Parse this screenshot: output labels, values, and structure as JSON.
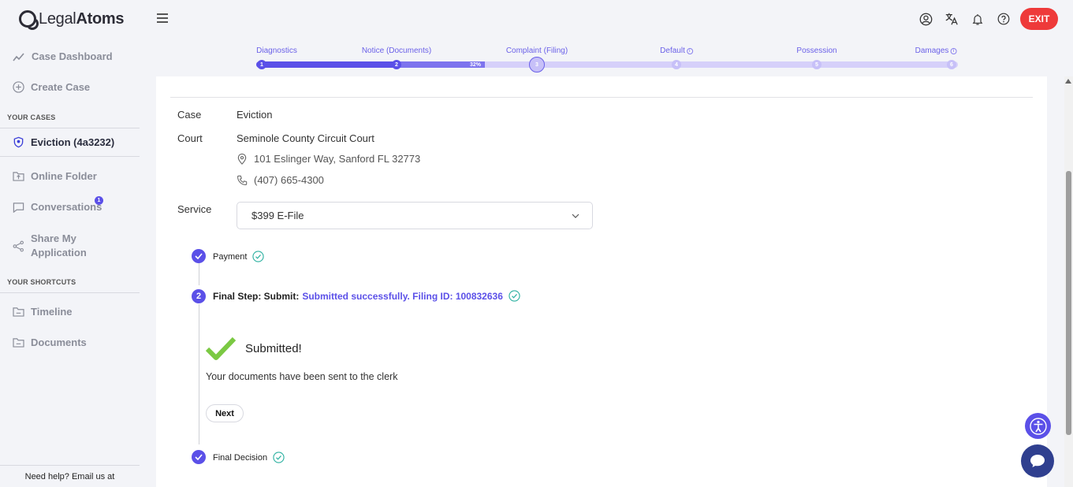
{
  "header": {
    "logo_light": "Legal",
    "logo_bold": "Atoms",
    "exit_label": "EXIT",
    "icons": [
      "user-icon",
      "translate-icon",
      "bell-icon",
      "help-icon"
    ]
  },
  "progress": {
    "steps": [
      {
        "label": "Diagnostics",
        "number": "1",
        "state": "done"
      },
      {
        "label": "Notice (Documents)",
        "number": "2",
        "state": "done"
      },
      {
        "label": "Complaint (Filing)",
        "number": "3",
        "state": "current"
      },
      {
        "label": "Default",
        "number": "4",
        "state": "pending",
        "info": true
      },
      {
        "label": "Possession",
        "number": "5",
        "state": "pending"
      },
      {
        "label": "Damages",
        "number": "6",
        "state": "pending",
        "info": true
      }
    ],
    "percent_label": "32%",
    "percent_value": 32
  },
  "sidebar": {
    "case_dashboard": "Case Dashboard",
    "create_case": "Create Case",
    "your_cases_title": "YOUR CASES",
    "active_case": "Eviction (4a3232)",
    "online_folder": "Online Folder",
    "conversations": "Conversations",
    "conversations_badge": "1",
    "share_line1": "Share My",
    "share_line2": "Application",
    "shortcuts_title": "YOUR SHORTCUTS",
    "timeline": "Timeline",
    "documents": "Documents",
    "help_text": "Need help? Email us at"
  },
  "case": {
    "case_label": "Case",
    "case_value": "Eviction",
    "court_label": "Court",
    "court_name": "Seminole County Circuit Court",
    "court_address": "101 Eslinger Way, Sanford FL 32773",
    "court_phone": "(407) 665-4300",
    "service_label": "Service",
    "service_value": "$399 E-File"
  },
  "steps": {
    "payment": "Payment",
    "final_step_number": "2",
    "final_step_prefix": "Final Step: Submit:",
    "final_step_status": "Submitted successfully. Filing ID: 100832636",
    "submitted_title": "Submitted!",
    "submitted_message": "Your documents have been sent to the clerk",
    "next_label": "Next",
    "final_decision": "Final Decision"
  },
  "colors": {
    "accent": "#5b50e8",
    "exit": "#ee3a3a",
    "success_check": "#7bc943",
    "teal_check": "#2bb0a0"
  }
}
